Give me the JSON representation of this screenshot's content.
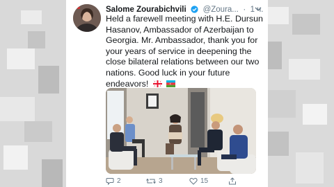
{
  "tweet": {
    "author_name": "Salome Zourabichvili",
    "author_handle": "@Zoura...",
    "separator": "·",
    "time": "1 ч.",
    "text": "Held a farewell meeting with H.E. Dursun Hasanov, Ambassador of Azerbaijan to Georgia. Mr. Ambassador, thank you for your years of service in deepening the close bilateral relations between our two nations. Good luck in your future endeavors!",
    "emojis": [
      "georgia-flag",
      "azerbaijan-flag"
    ]
  },
  "actions": {
    "reply_count": "2",
    "retweet_count": "3",
    "like_count": "15"
  },
  "icons": [
    "avatar",
    "verified-icon",
    "chevron-down-icon",
    "reply-icon",
    "retweet-icon",
    "like-icon",
    "share-icon"
  ],
  "colors": {
    "text": "#14171a",
    "secondary": "#657786",
    "verified_blue": "#1da1f2",
    "background": "#ffffff"
  }
}
